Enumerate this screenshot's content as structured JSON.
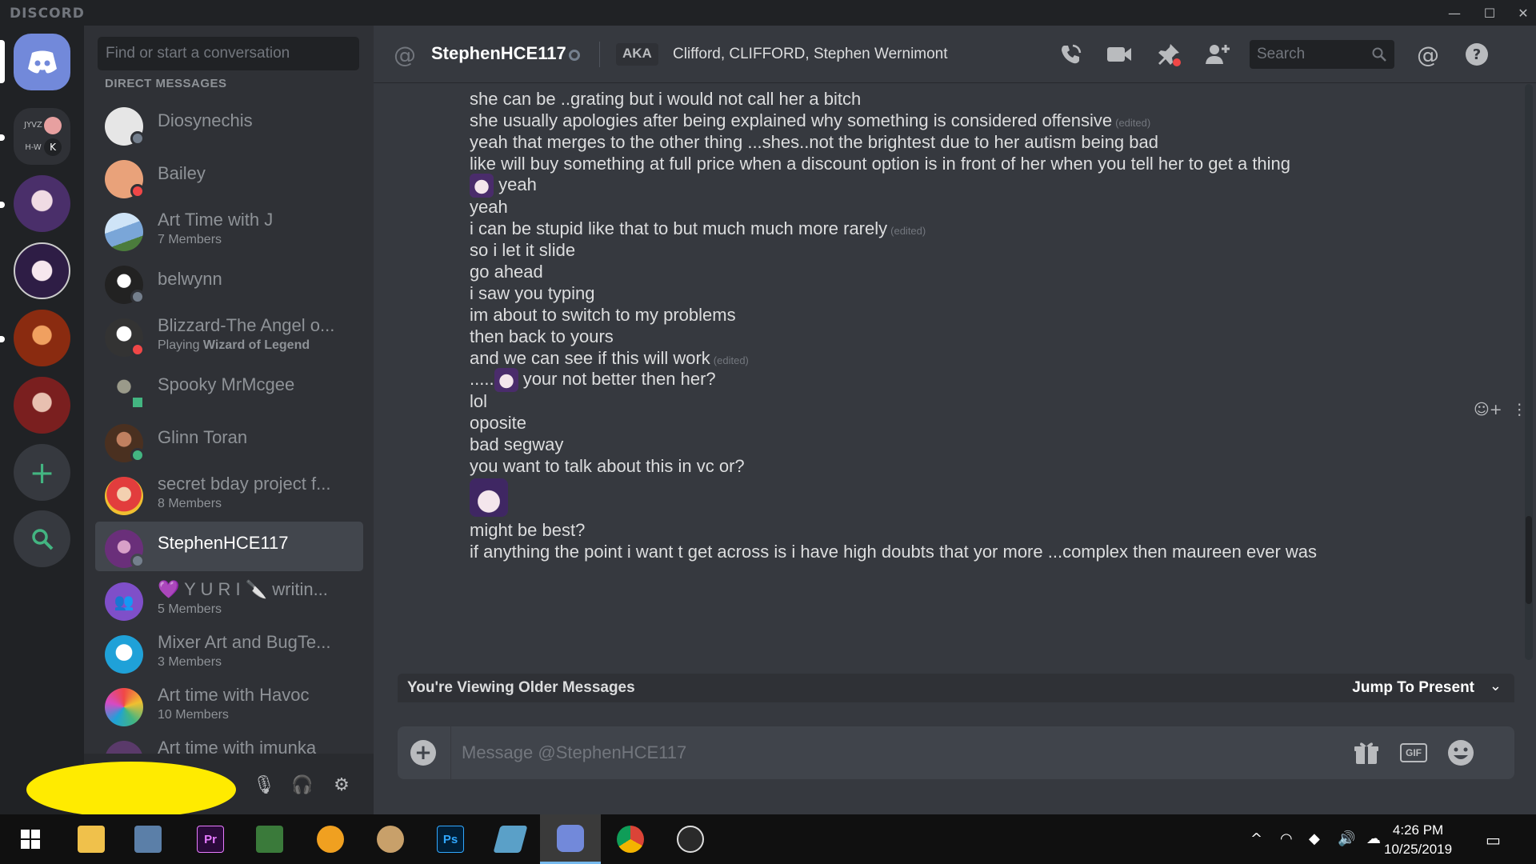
{
  "window": {
    "brand": "DISCORD",
    "controls": {
      "minimize": "—",
      "maximize": "☐",
      "close": "✕"
    }
  },
  "dm_sidebar": {
    "search_placeholder": "Find or start a conversation",
    "header": "DIRECT MESSAGES",
    "items": [
      {
        "name": "Diosynechis",
        "sub": "",
        "status_color": "#747f8d",
        "avatar_color": "#e6e6e6"
      },
      {
        "name": "Bailey",
        "sub": "",
        "status_color": "#f04747",
        "avatar_color": "#e9a27a"
      },
      {
        "name": "Art Time with J",
        "sub": "7 Members",
        "status_color": "",
        "avatar_color": "#7aa6d8"
      },
      {
        "name": "belwynn",
        "sub": "",
        "status_color": "#747f8d",
        "avatar_color": "#222222"
      },
      {
        "name": "Blizzard-The Angel o...",
        "sub_prefix": "Playing ",
        "sub_bold": "Wizard of Legend",
        "status_color": "#f04747",
        "avatar_color": "#d9d9d9"
      },
      {
        "name": "Spooky MrMcgee",
        "sub": "",
        "status_color": "#43b581",
        "avatar_color": "#4a4a3a"
      },
      {
        "name": "Glinn Toran",
        "sub": "",
        "status_color": "#43b581",
        "avatar_color": "#6b4a3a"
      },
      {
        "name": "secret bday project f...",
        "sub": "8 Members",
        "status_color": "",
        "avatar_color": "#e23d3d"
      },
      {
        "name": "StephenHCE117",
        "sub": "",
        "status_color": "#747f8d",
        "avatar_color": "#7a4a8a"
      },
      {
        "name": "💜 Y U R I 🔪 writin...",
        "sub": "5 Members",
        "status_color": "",
        "avatar_color": "#7f4fc9"
      },
      {
        "name": "Mixer Art and BugTe...",
        "sub": "3 Members",
        "status_color": "",
        "avatar_color": "#1fa1d8"
      },
      {
        "name": "Art time with Havoc",
        "sub": "10 Members",
        "status_color": "",
        "avatar_color": "#d64ac4"
      },
      {
        "name": "Art time with imunka",
        "sub": "",
        "status_color": "",
        "avatar_color": "#5a3a6a"
      }
    ]
  },
  "servers": [
    {
      "label": "JYVZ H-W K",
      "color": "#2f3136"
    },
    {
      "label": "",
      "color": "#5d4c80"
    },
    {
      "label": "",
      "color": "#3b2a55"
    },
    {
      "label": "",
      "color": "#b3431f"
    },
    {
      "label": "",
      "color": "#8c2b2b"
    }
  ],
  "user_panel": {
    "mute_icon": "🎙",
    "deafen_icon": "🎧",
    "settings_icon": "⚙"
  },
  "header": {
    "channel_name": "StephenHCE117",
    "aka_label": "AKA",
    "aka_names": "Clifford, CLIFFORD, Stephen Wernimont",
    "search_placeholder": "Search"
  },
  "messages": [
    {
      "text": "she can be ..grating but i would not call her a bitch",
      "edited": ""
    },
    {
      "text": "she usually apologies after being explained why something is considered offensive",
      "edited": "(edited)"
    },
    {
      "text": "yeah that merges to the other thing ...shes..not the brightest due to her autism being bad",
      "edited": ""
    },
    {
      "text": "like will buy something at full price when a discount option is in front of her when you tell her to get a thing",
      "edited": ""
    },
    {
      "text": "yeah",
      "edited": "",
      "emoji_before": true
    },
    {
      "text": "yeah",
      "edited": ""
    },
    {
      "text": "i can be stupid like that to but much much more rarely",
      "edited": "(edited)"
    },
    {
      "text": "so i let it slide",
      "edited": ""
    },
    {
      "text": "go ahead",
      "edited": ""
    },
    {
      "text": "i saw you typing",
      "edited": ""
    },
    {
      "text": "im about to switch to my problems",
      "edited": ""
    },
    {
      "text": "then back to yours",
      "edited": ""
    },
    {
      "text": "and we can see if this will work",
      "edited": "(edited)"
    },
    {
      "prefix": ".....",
      "text": "your not better then her?",
      "edited": "",
      "emoji_inline": true
    },
    {
      "text": "lol",
      "edited": ""
    },
    {
      "text": "oposite",
      "edited": ""
    },
    {
      "text": "bad segway",
      "edited": ""
    },
    {
      "text": "you want to talk about this in vc or?",
      "edited": ""
    },
    {
      "text": "might be best?",
      "edited": ""
    },
    {
      "text": "if anything the point i want t get across is i have high doubts that yor more ...complex then maureen ever was",
      "edited": ""
    }
  ],
  "older_bar": {
    "text": "You're Viewing Older Messages",
    "jump": "Jump To Present"
  },
  "composer": {
    "placeholder": "Message @StephenHCE117"
  },
  "taskbar": {
    "apps": [
      {
        "name": "file-explorer",
        "label": "",
        "color": "#f0c14b"
      },
      {
        "name": "notepad",
        "label": "",
        "color": "#5b7fa8"
      },
      {
        "name": "premiere",
        "label": "Pr",
        "color": "#2a0a3a"
      },
      {
        "name": "sheets",
        "label": "",
        "color": "#3a7a3a"
      },
      {
        "name": "app-orange",
        "label": "",
        "color": "#f0a020"
      },
      {
        "name": "paint",
        "label": "",
        "color": "#c8a06a"
      },
      {
        "name": "photoshop",
        "label": "Ps",
        "color": "#001e36"
      },
      {
        "name": "gem",
        "label": "",
        "color": "#5aa0c8"
      },
      {
        "name": "discord",
        "label": "",
        "color": "#7289da"
      },
      {
        "name": "chrome",
        "label": "",
        "color": "#db4437"
      },
      {
        "name": "obs",
        "label": "",
        "color": "#2a2a2a"
      }
    ],
    "time": "4:26 PM",
    "date": "10/25/2019"
  }
}
